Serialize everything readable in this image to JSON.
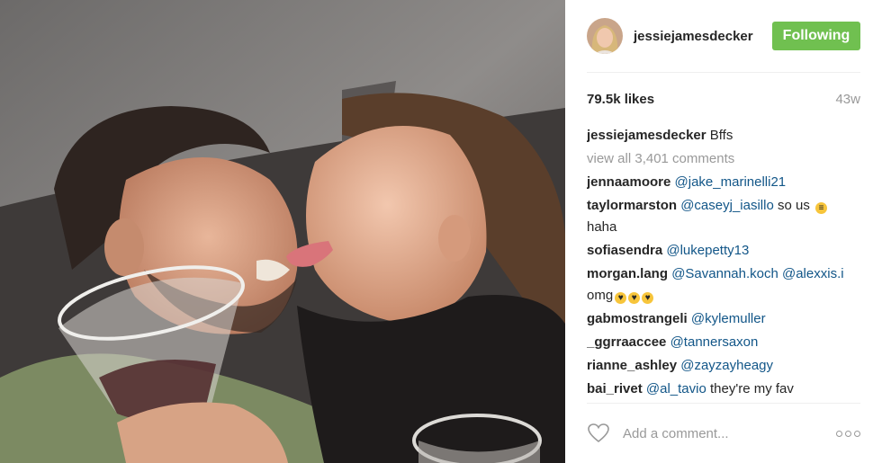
{
  "header": {
    "username": "jessiejamesdecker",
    "follow_label": "Following"
  },
  "stats": {
    "likes": "79.5k likes",
    "age": "43w"
  },
  "caption": {
    "user": "jessiejamesdecker",
    "text": "Bffs"
  },
  "view_all": "view all 3,401 comments",
  "comments": [
    {
      "user": "jennaamoore",
      "mention": "@jake_marinelli21",
      "text": ""
    },
    {
      "user": "taylormarston",
      "mention": "@caseyj_iasillo",
      "text": " so us ",
      "emoji": "grimace",
      "text2": "haha"
    },
    {
      "user": "sofiasendra",
      "mention": "@lukepetty13",
      "text": ""
    },
    {
      "user": "morgan.lang",
      "mention": "@Savannah.koch @alexxis.i",
      "text": "omg",
      "emoji_count": 3
    },
    {
      "user": "gabmostrangeli",
      "mention": "@kylemuller",
      "text": ""
    },
    {
      "user": "_ggrraaccee",
      "mention": "@tannersaxon",
      "text": ""
    },
    {
      "user": "rianne_ashley",
      "mention": "@zayzayheagy",
      "text": ""
    },
    {
      "user": "bai_rivet",
      "mention": "@al_tavio",
      "text": " they're my fav"
    }
  ],
  "footer": {
    "placeholder": "Add a comment..."
  },
  "icons": {
    "like": "heart-icon",
    "more": "more-options-icon"
  },
  "colors": {
    "follow_button": "#70c050",
    "mention": "#125688",
    "muted": "#999999"
  }
}
